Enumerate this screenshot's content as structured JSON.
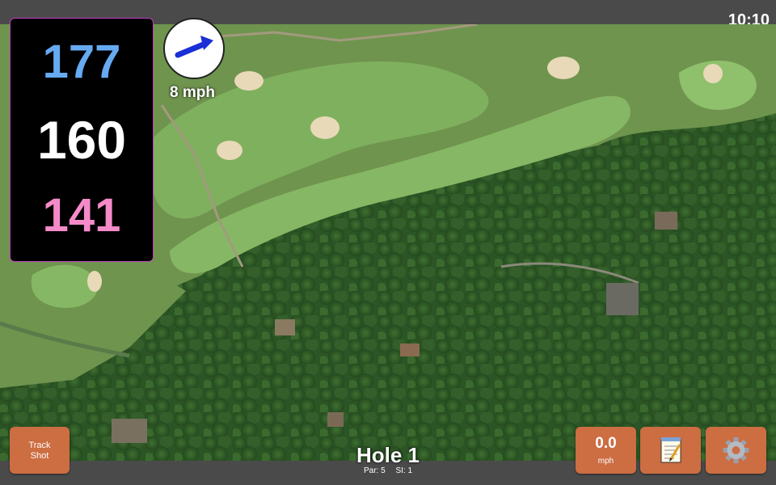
{
  "status": {
    "time": "10:10"
  },
  "distances": {
    "back": "177",
    "middle": "160",
    "front": "141",
    "back_color": "#66aaf2",
    "middle_color": "#ffffff",
    "front_color": "#f58ac9",
    "panel_border": "#c040c0"
  },
  "wind": {
    "speed": "8 mph",
    "arrow_color": "#1a2fd6",
    "speed_text_color": "#ffffff",
    "speed_outline": "#a040c0"
  },
  "hole": {
    "title": "Hole 1",
    "par": "Par: 5",
    "si": "SI: 1"
  },
  "buttons": {
    "track_shot": "Track\nShot",
    "speed_value": "0.0",
    "speed_unit": "mph",
    "notes_icon": "notepad-icon",
    "settings_icon": "gear-icon",
    "button_color": "#cc6d42"
  },
  "map": {
    "type": "satellite-golf-course",
    "fairway_color": "#7aab5a",
    "rough_color": "#5e8a44",
    "tree_color": "#2f5a27",
    "bunker_color": "#e8d9b8"
  }
}
